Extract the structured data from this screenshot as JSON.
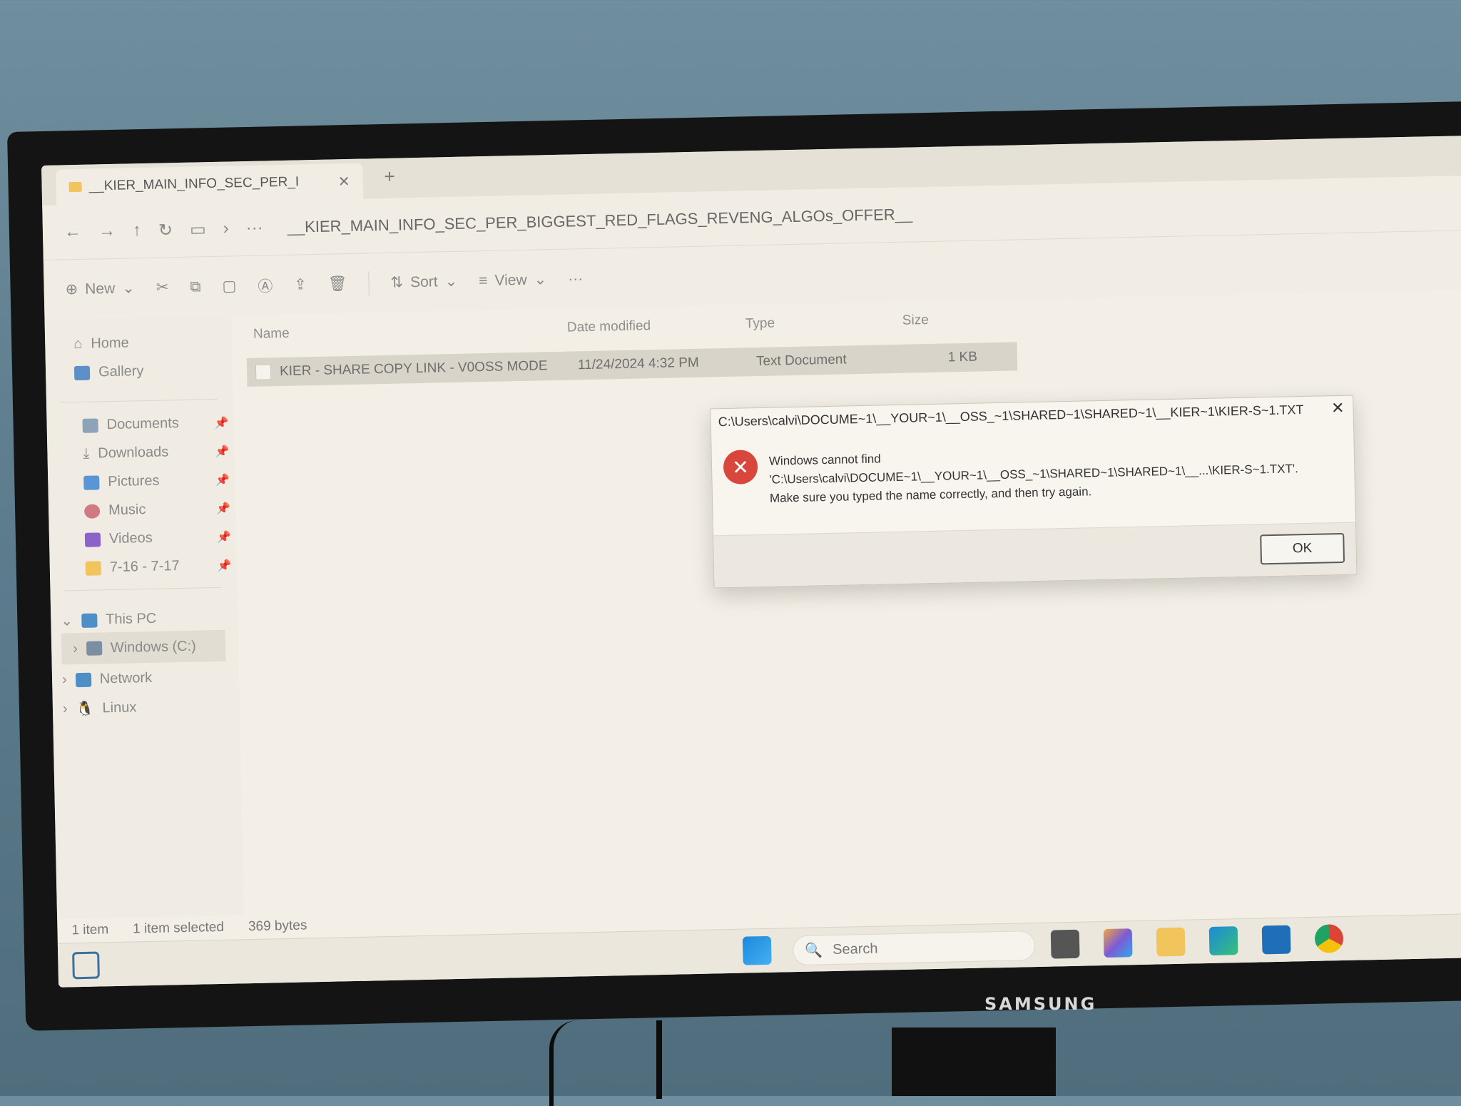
{
  "explorer": {
    "tab_title": "__KIER_MAIN_INFO_SEC_PER_I",
    "tab_close": "✕",
    "new_tab": "+",
    "address_path": "__KIER_MAIN_INFO_SEC_PER_BIGGEST_RED_FLAGS_REVENG_ALGOs_OFFER__",
    "toolbar": {
      "new_label": "New",
      "sort_label": "Sort",
      "view_label": "View",
      "more_label": "···"
    },
    "sidebar": {
      "home": "Home",
      "gallery": "Gallery",
      "documents": "Documents",
      "downloads": "Downloads",
      "pictures": "Pictures",
      "music": "Music",
      "videos": "Videos",
      "folder_716": "7-16 - 7-17",
      "this_pc": "This PC",
      "windows_c": "Windows (C:)",
      "network": "Network",
      "linux": "Linux"
    },
    "columns": {
      "name": "Name",
      "date": "Date modified",
      "type": "Type",
      "size": "Size"
    },
    "file": {
      "name": "KIER - SHARE COPY LINK - V0OSS MODE",
      "date": "11/24/2024 4:32 PM",
      "type": "Text Document",
      "size": "1 KB"
    },
    "status": {
      "items": "1 item",
      "selected": "1 item selected",
      "bytes": "369 bytes"
    }
  },
  "dialog": {
    "title": "C:\\Users\\calvi\\DOCUME~1\\__YOUR~1\\__OSS_~1\\SHARED~1\\SHARED~1\\__KIER~1\\KIER-S~1.TXT",
    "close": "✕",
    "line1": "Windows cannot find",
    "line2": "'C:\\Users\\calvi\\DOCUME~1\\__YOUR~1\\__OSS_~1\\SHARED~1\\SHARED~1\\__...\\KIER-S~1.TXT'.",
    "line3": "Make sure you typed the name correctly, and then try again.",
    "ok": "OK"
  },
  "taskbar": {
    "search_placeholder": "Search"
  },
  "monitor": {
    "brand": "SAMSUNG"
  },
  "colors": {
    "error_red": "#d9463b",
    "accent_blue": "#1e88d9"
  }
}
